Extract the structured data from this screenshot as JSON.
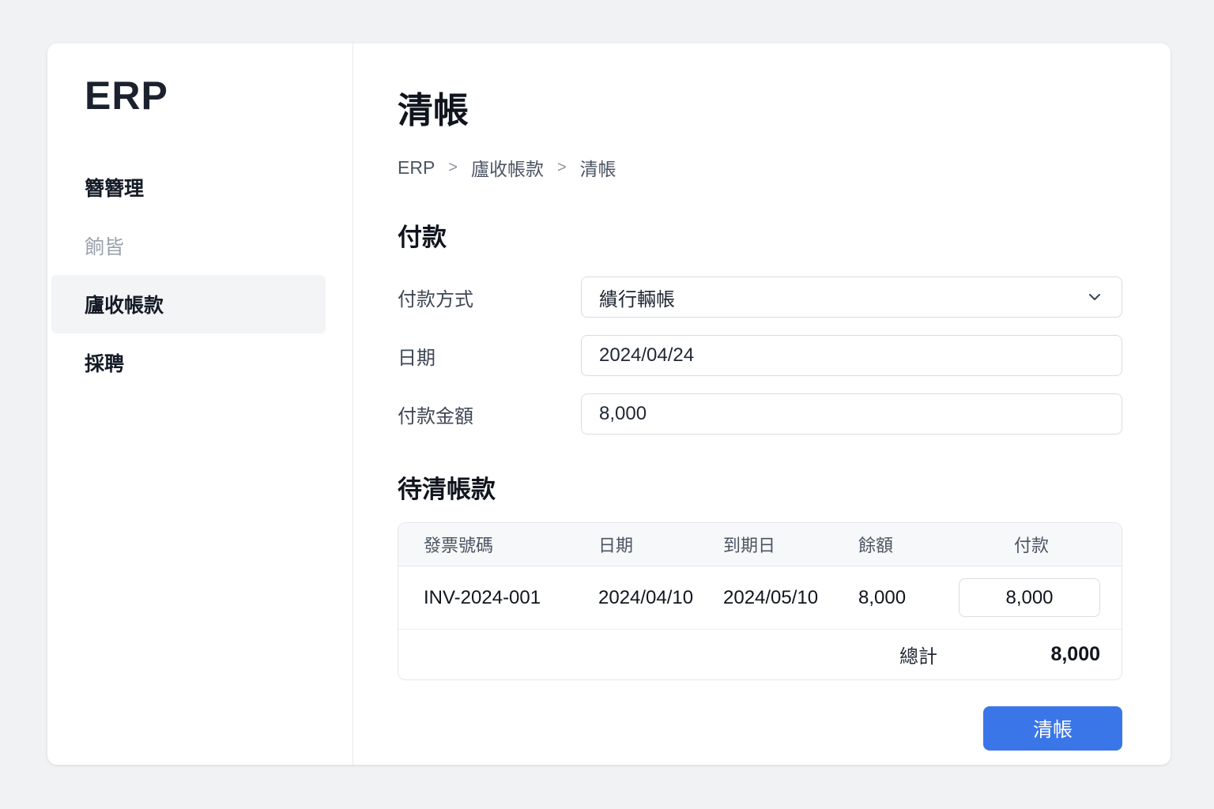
{
  "app": {
    "logo": "ERP"
  },
  "sidebar": {
    "items": [
      {
        "label": "簪簪理",
        "state": "default"
      },
      {
        "label": "餉皆",
        "state": "muted"
      },
      {
        "label": "廬收帳款",
        "state": "active"
      },
      {
        "label": "採聘",
        "state": "default"
      }
    ]
  },
  "header": {
    "title": "清帳",
    "breadcrumb": {
      "items": [
        "ERP",
        "廬收帳款",
        "清帳"
      ],
      "separator": ">"
    }
  },
  "payment": {
    "section_title": "付款",
    "method_label": "付款方式",
    "method_value": "繢行輛帳",
    "date_label": "日期",
    "date_value": "2024/04/24",
    "amount_label": "付款金額",
    "amount_value": "8,000"
  },
  "pending": {
    "section_title": "待清帳款",
    "table": {
      "headers": [
        "發票號碼",
        "日期",
        "到期日",
        "餘額",
        "付款"
      ],
      "rows": [
        {
          "invoice_no": "INV-2024-001",
          "date": "2024/04/10",
          "due_date": "2024/05/10",
          "balance": "8,000",
          "payment_value": "8,000"
        }
      ],
      "footer": {
        "label": "總計",
        "total": "8,000"
      }
    }
  },
  "actions": {
    "settle_label": "清帳"
  },
  "colors": {
    "accent": "#3b76e8"
  }
}
